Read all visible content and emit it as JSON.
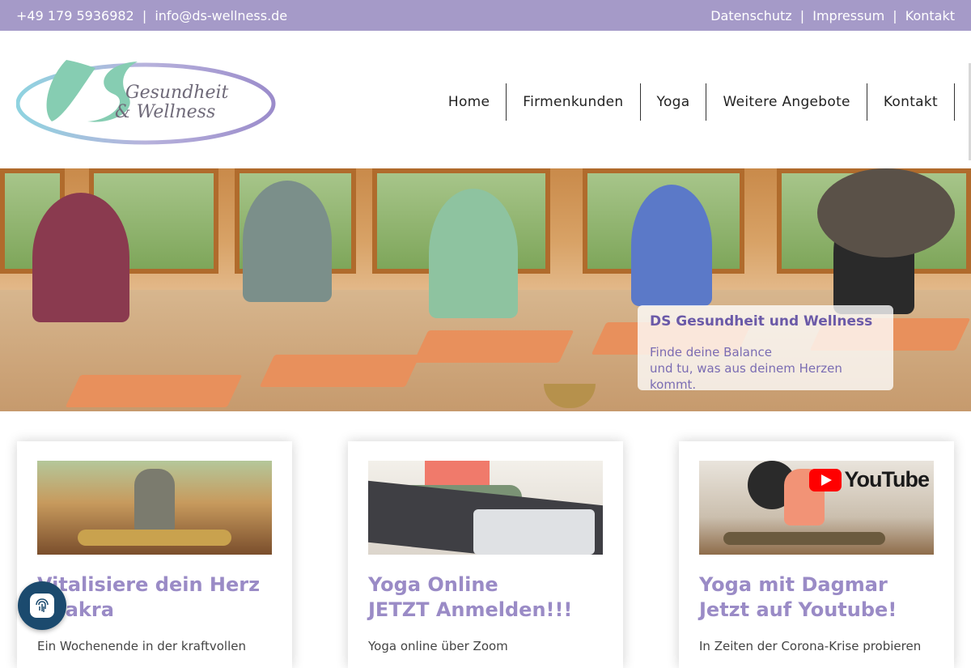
{
  "topbar": {
    "phone": "+49 179 5936982",
    "separator": "|",
    "email": "info@ds-wellness.de",
    "links": [
      "Datenschutz",
      "Impressum",
      "Kontakt"
    ]
  },
  "logo": {
    "monogram": "DS",
    "line1": "Gesundheit",
    "line2": "& Wellness"
  },
  "nav": {
    "items": [
      "Home",
      "Firmenkunden",
      "Yoga",
      "Weitere Angebote",
      "Kontakt"
    ]
  },
  "hero": {
    "title": "DS Gesundheit und Wellness",
    "line1": "Finde deine Balance",
    "line2": "und tu, was aus deinem Herzen kommt."
  },
  "cards": [
    {
      "title1": "Vitalisiere dein Herz",
      "title2": "Chakra",
      "text": "Ein Wochenende in der kraftvollen"
    },
    {
      "title1": "Yoga Online",
      "title2": "JETZT Anmelden!!!",
      "text": "Yoga online über Zoom"
    },
    {
      "title1": "Yoga mit Dagmar",
      "title2": "Jetzt auf Youtube!",
      "text": "In Zeiten der Corona-Krise probieren"
    }
  ],
  "youtube": {
    "label": "YouTube"
  },
  "colors": {
    "topbar": "#a59ac8",
    "accent": "#9a8bc6",
    "hero_title": "#6b5aa8",
    "fab": "#1b4a6e"
  },
  "icons": {
    "fab": "fingerprint-icon"
  }
}
